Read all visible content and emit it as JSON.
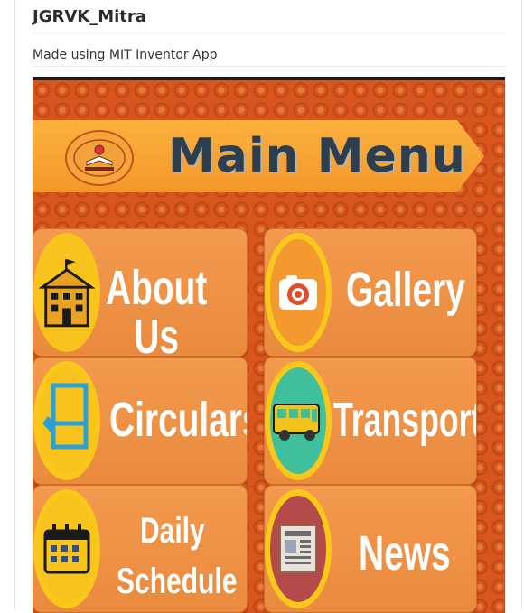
{
  "header": {
    "title": "JGRVK_Mitra",
    "subtitle": "Made using MIT Inventor App"
  },
  "app": {
    "banner_title": "Main Menu",
    "tiles": [
      {
        "label": "About Us",
        "icon": "school-building-icon"
      },
      {
        "label": "Gallery",
        "icon": "camera-icon"
      },
      {
        "label": "Circulars",
        "icon": "document-pencil-icon"
      },
      {
        "label": "Transport",
        "icon": "bus-icon"
      },
      {
        "label_line1": "Daily",
        "label_line2": "Schedule",
        "icon": "calendar-icon"
      },
      {
        "label": "News",
        "icon": "newspaper-icon"
      }
    ]
  },
  "colors": {
    "tile": "#ec8d40",
    "circle": "#f9c81a",
    "background": "#d7561d",
    "banner": "#f7a43a",
    "banner_text": "#2f3e4d"
  }
}
